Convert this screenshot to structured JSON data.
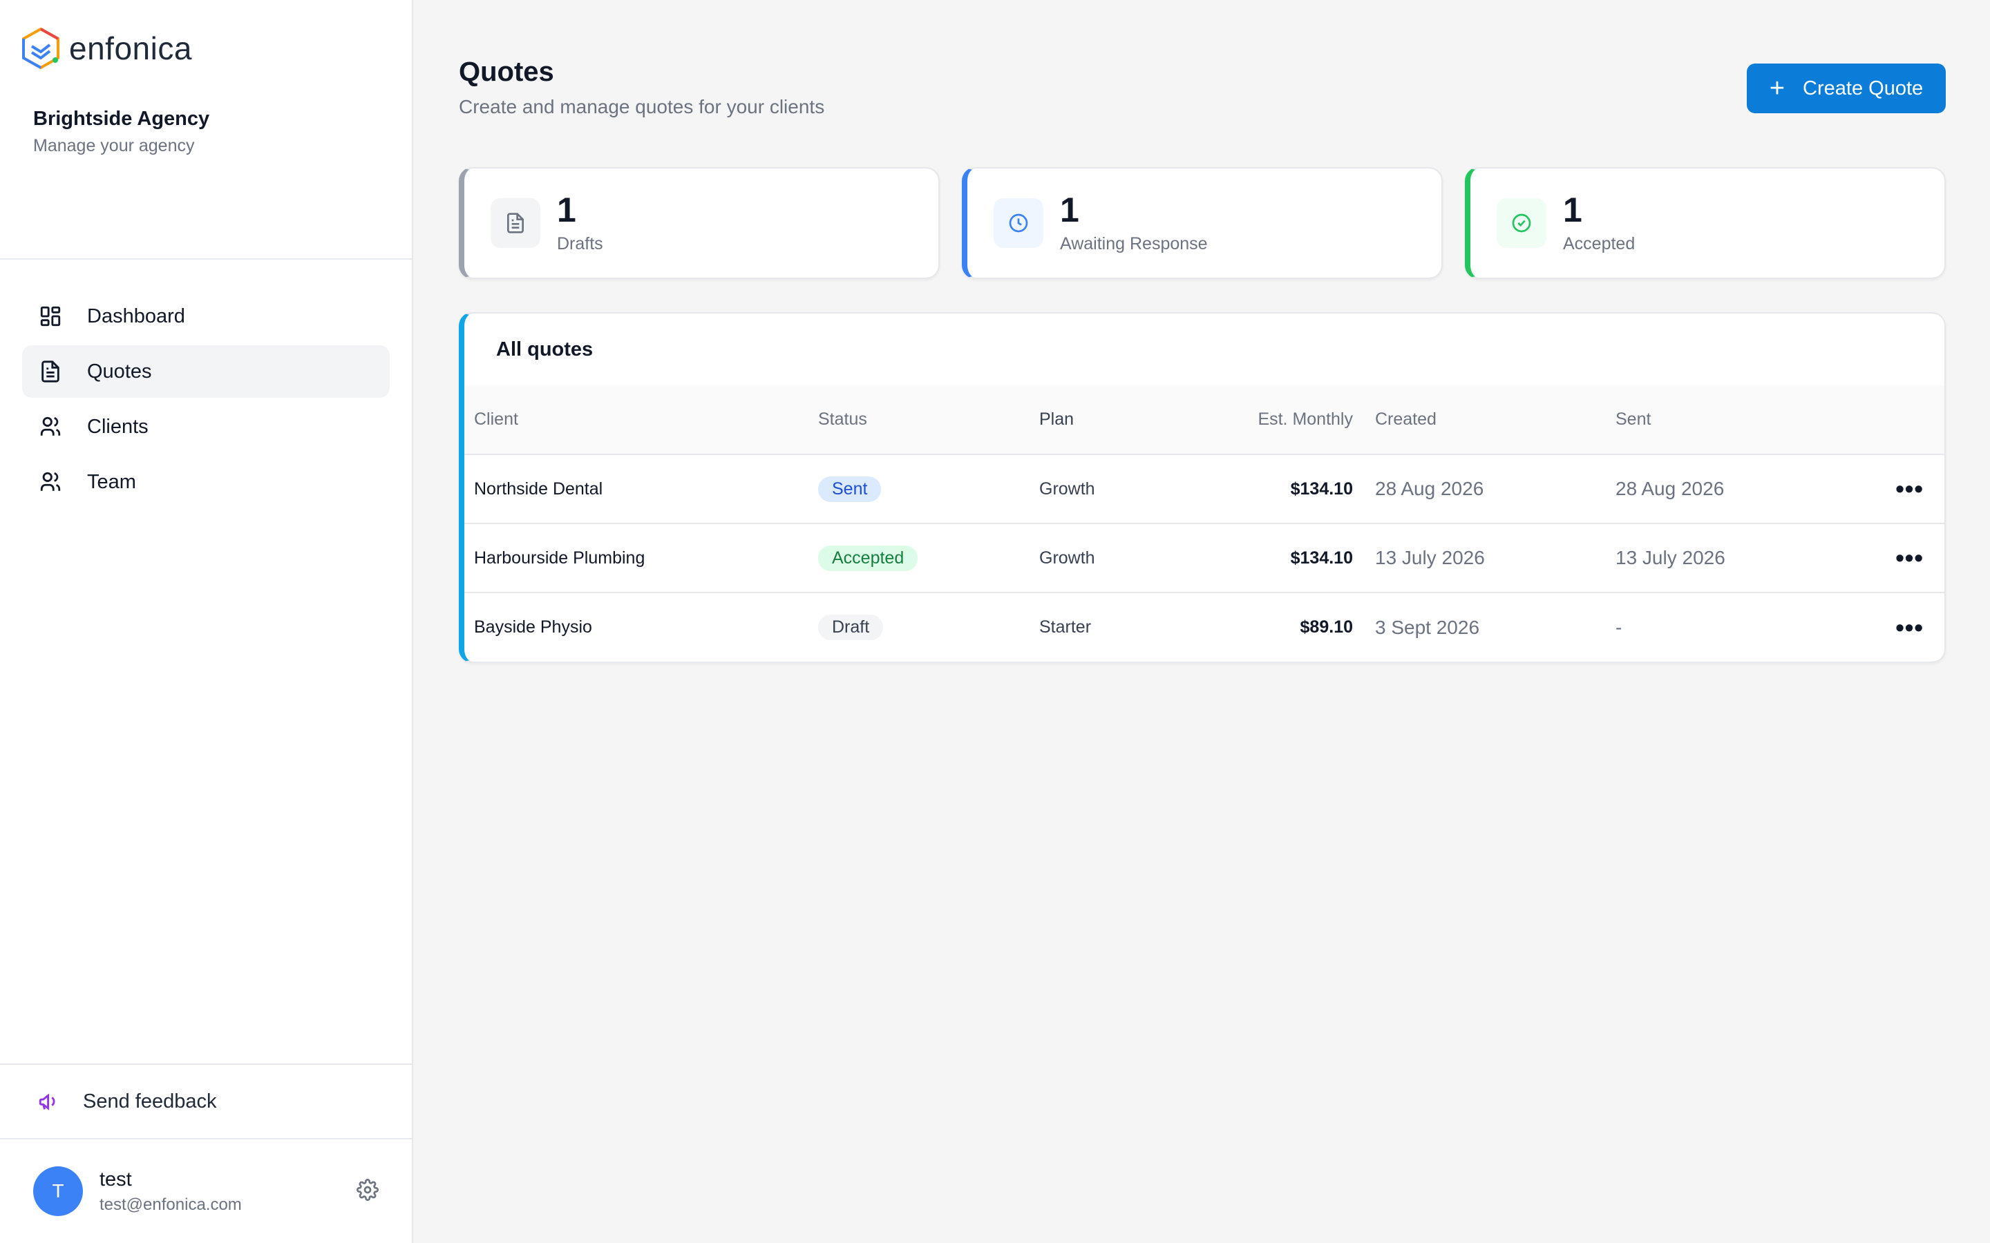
{
  "brand": {
    "name": "enfonica"
  },
  "agency": {
    "name": "Brightside Agency",
    "subtitle": "Manage your agency"
  },
  "nav": {
    "items": [
      {
        "label": "Dashboard",
        "icon": "dashboard-icon"
      },
      {
        "label": "Quotes",
        "icon": "document-icon",
        "active": true
      },
      {
        "label": "Clients",
        "icon": "users-icon"
      },
      {
        "label": "Team",
        "icon": "users-icon"
      }
    ]
  },
  "feedback": {
    "label": "Send feedback"
  },
  "user": {
    "initial": "T",
    "name": "test",
    "email": "test@enfonica.com"
  },
  "page": {
    "title": "Quotes",
    "subtitle": "Create and manage quotes for your clients",
    "create_label": "Create Quote"
  },
  "stats": [
    {
      "value": "1",
      "label": "Drafts",
      "color": "#9ca3af"
    },
    {
      "value": "1",
      "label": "Awaiting Response",
      "color": "#3b82f6"
    },
    {
      "value": "1",
      "label": "Accepted",
      "color": "#22c55e"
    }
  ],
  "table": {
    "title": "All quotes",
    "columns": [
      "Client",
      "Status",
      "Plan",
      "Est. Monthly",
      "Created",
      "Sent"
    ],
    "rows": [
      {
        "client": "Northside Dental",
        "status": "Sent",
        "plan": "Growth",
        "est": "$134.10",
        "created": "28 Aug 2026",
        "sent": "28 Aug 2026"
      },
      {
        "client": "Harbourside Plumbing",
        "status": "Accepted",
        "plan": "Growth",
        "est": "$134.10",
        "created": "13 July 2026",
        "sent": "13 July 2026"
      },
      {
        "client": "Bayside Physio",
        "status": "Draft",
        "plan": "Starter",
        "est": "$89.10",
        "created": "3 Sept 2026",
        "sent": "-"
      }
    ],
    "more_label": "•••"
  },
  "colors": {
    "primary": "#0b7dd8",
    "accent_table": "#0ea5e9",
    "avatar": "#3b82f6",
    "feedback_icon": "#9333ea"
  }
}
